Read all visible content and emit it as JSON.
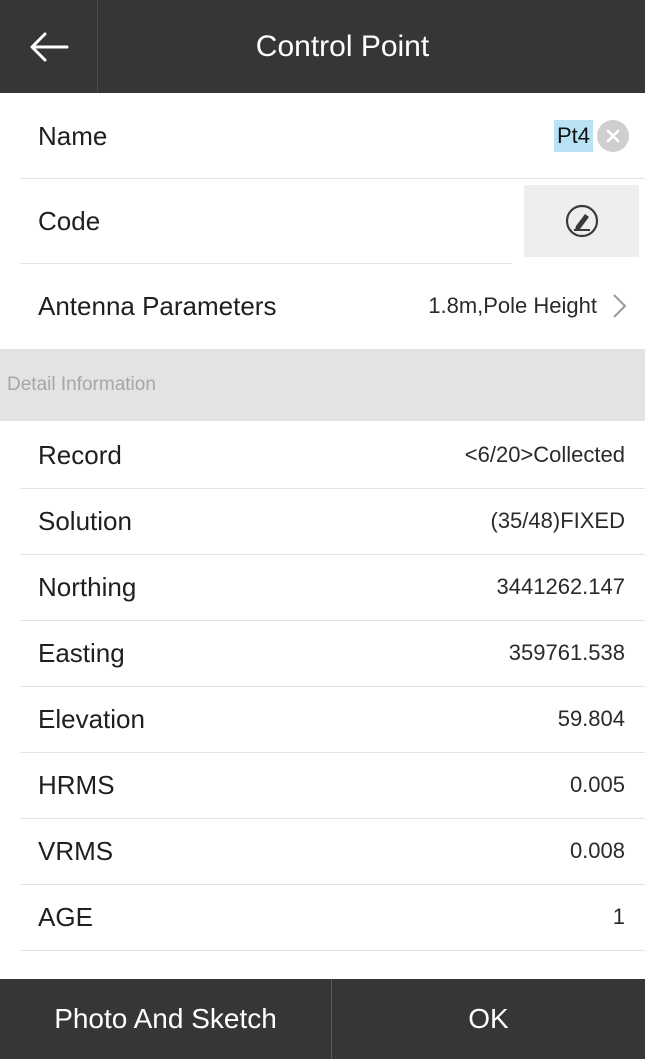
{
  "header": {
    "title": "Control Point"
  },
  "form": {
    "name_label": "Name",
    "name_value": "Pt4",
    "code_label": "Code",
    "antenna_label": "Antenna Parameters",
    "antenna_value": "1.8m,Pole Height"
  },
  "section": {
    "title": "Detail Information"
  },
  "details": [
    {
      "label": "Record",
      "value": "<6/20>Collected"
    },
    {
      "label": "Solution",
      "value": "(35/48)FIXED"
    },
    {
      "label": "Northing",
      "value": "3441262.147"
    },
    {
      "label": "Easting",
      "value": "359761.538"
    },
    {
      "label": "Elevation",
      "value": "59.804"
    },
    {
      "label": "HRMS",
      "value": "0.005"
    },
    {
      "label": "VRMS",
      "value": "0.008"
    },
    {
      "label": "AGE",
      "value": "1"
    }
  ],
  "footer": {
    "photo_label": "Photo And Sketch",
    "ok_label": "OK"
  },
  "icons": {
    "back": "arrow-left-icon",
    "clear": "clear-circle-icon",
    "code": "pen-circle-icon",
    "chevron": "chevron-right-icon"
  },
  "colors": {
    "bar": "#363636",
    "selection": "#b9e3f5",
    "section_bg": "#e3e3e3"
  }
}
